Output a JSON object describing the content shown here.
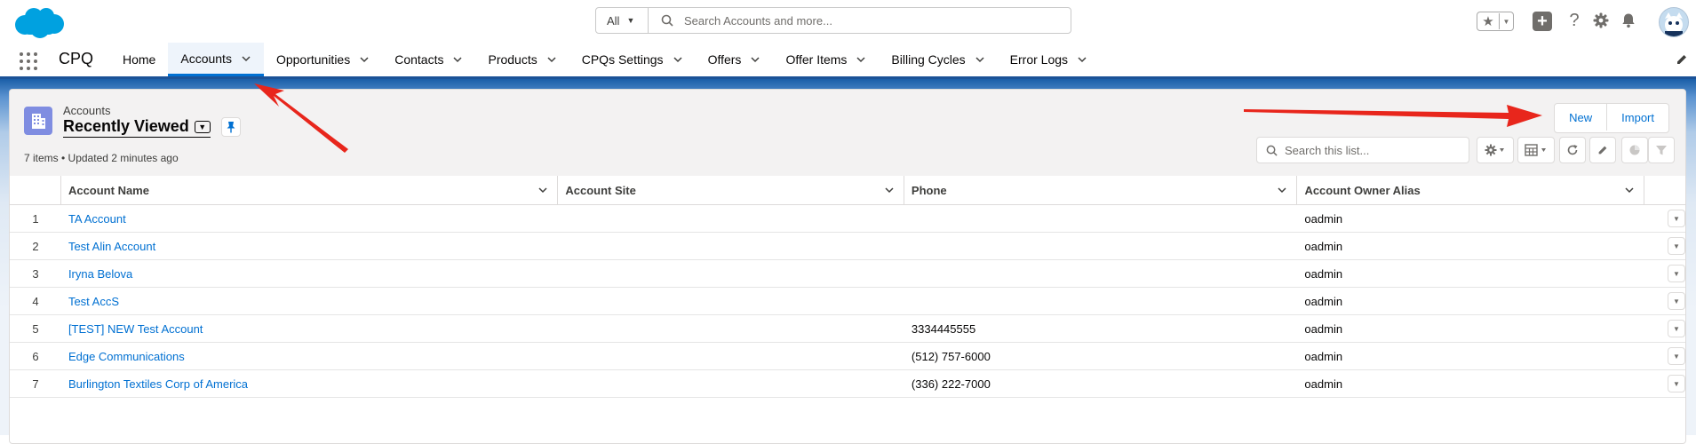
{
  "header": {
    "search": {
      "scope": "All",
      "placeholder": "Search Accounts and more..."
    }
  },
  "nav": {
    "app_name": "CPQ",
    "items": [
      {
        "label": "Home",
        "has_menu": false,
        "active": false
      },
      {
        "label": "Accounts",
        "has_menu": true,
        "active": true
      },
      {
        "label": "Opportunities",
        "has_menu": true,
        "active": false
      },
      {
        "label": "Contacts",
        "has_menu": true,
        "active": false
      },
      {
        "label": "Products",
        "has_menu": true,
        "active": false
      },
      {
        "label": "CPQs Settings",
        "has_menu": true,
        "active": false
      },
      {
        "label": "Offers",
        "has_menu": true,
        "active": false
      },
      {
        "label": "Offer Items",
        "has_menu": true,
        "active": false
      },
      {
        "label": "Billing Cycles",
        "has_menu": true,
        "active": false
      },
      {
        "label": "Error Logs",
        "has_menu": true,
        "active": false
      }
    ]
  },
  "list": {
    "object_label": "Accounts",
    "view_name": "Recently Viewed",
    "meta": "7 items • Updated 2 minutes ago",
    "buttons": {
      "new": "New",
      "import": "Import"
    },
    "search_placeholder": "Search this list...",
    "columns": [
      "Account Name",
      "Account Site",
      "Phone",
      "Account Owner Alias"
    ],
    "rows": [
      {
        "num": "1",
        "name": "TA Account",
        "site": "",
        "phone": "",
        "owner": "oadmin"
      },
      {
        "num": "2",
        "name": "Test Alin Account",
        "site": "",
        "phone": "",
        "owner": "oadmin"
      },
      {
        "num": "3",
        "name": "Iryna Belova",
        "site": "",
        "phone": "",
        "owner": "oadmin"
      },
      {
        "num": "4",
        "name": "Test AccS",
        "site": "",
        "phone": "",
        "owner": "oadmin"
      },
      {
        "num": "5",
        "name": "[TEST] NEW Test Account",
        "site": "",
        "phone": "3334445555",
        "owner": "oadmin"
      },
      {
        "num": "6",
        "name": "Edge Communications",
        "site": "",
        "phone": "(512) 757-6000",
        "owner": "oadmin"
      },
      {
        "num": "7",
        "name": "Burlington Textiles Corp of America",
        "site": "",
        "phone": "(336) 222-7000",
        "owner": "oadmin"
      }
    ]
  },
  "colors": {
    "brand_blue": "#0070d2",
    "nav_border": "#1b5297",
    "annotation_arrow": "#e8261c",
    "object_icon": "#7f8de1"
  }
}
